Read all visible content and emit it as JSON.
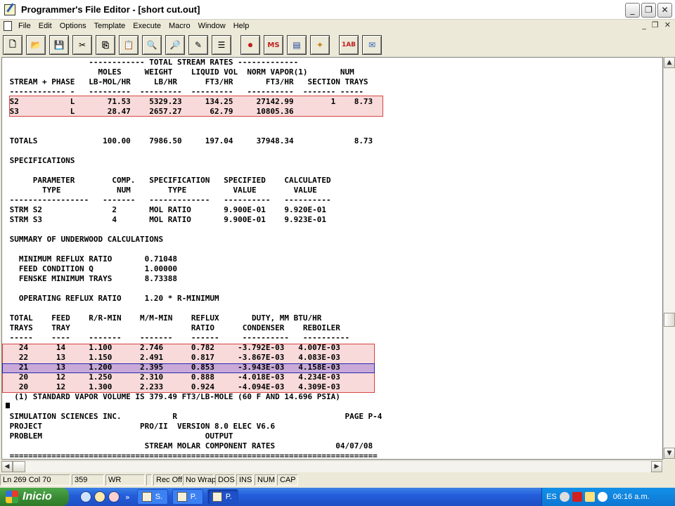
{
  "window": {
    "title": "Programmer's File Editor - [short cut.out]",
    "buttons": {
      "minimize": "_",
      "maximize": "❐",
      "close": "✕"
    }
  },
  "menu": [
    "File",
    "Edit",
    "Options",
    "Template",
    "Execute",
    "Macro",
    "Window",
    "Help"
  ],
  "mdi_buttons": {
    "minimize": "_",
    "restore": "❐",
    "close": "✕"
  },
  "toolbar": {
    "buttons": [
      {
        "name": "new-file-icon",
        "glyph": "🗋"
      },
      {
        "name": "open-folder-icon",
        "glyph": "📂"
      },
      {
        "name": "save-disk-icon",
        "glyph": "💾"
      },
      {
        "name": "cut-scissors-icon",
        "glyph": "✂"
      },
      {
        "name": "copy-icon",
        "glyph": "⎘"
      },
      {
        "name": "paste-icon",
        "glyph": "📋"
      },
      {
        "name": "search-icon",
        "glyph": "🔍"
      },
      {
        "name": "find-next-icon",
        "glyph": "🔎"
      },
      {
        "name": "pen-icon",
        "glyph": "✎"
      },
      {
        "name": "list-icon",
        "glyph": "☰"
      },
      {
        "name": "record-macro-icon",
        "glyph": "⏺"
      },
      {
        "name": "ms-dos-icon",
        "glyph": "MS"
      },
      {
        "name": "window-icon",
        "glyph": "▤"
      },
      {
        "name": "wand-icon",
        "glyph": "✦"
      },
      {
        "name": "1ab-2cl-icon",
        "glyph": "1AB"
      },
      {
        "name": "stamp-icon",
        "glyph": "✉"
      }
    ]
  },
  "editor": {
    "lines": [
      "                  ------------ TOTAL STREAM RATES -------------",
      "                    MOLES     WEIGHT    LIQUID VOL  NORM VAPOR(1)       NUM",
      " STREAM + PHASE   LB-MOL/HR     LB/HR      FT3/HR       FT3/HR   SECTION TRAYS",
      " ------------ -   ---------  ---------  ---------   ----------  ------- -----",
      " S2           L       71.53    5329.23     134.25     27142.99        1    8.73",
      " S3           L       28.47    2657.27      62.79     10805.36",
      "",
      "",
      " TOTALS              100.00    7986.50     197.04     37948.34             8.73",
      "",
      " SPECIFICATIONS",
      "",
      "      PARAMETER        COMP.   SPECIFICATION   SPECIFIED    CALCULATED",
      "        TYPE            NUM        TYPE          VALUE        VALUE",
      " -----------------   -------   -------------   ----------   ----------",
      " STRM S2               2       MOL RATIO       9.900E-01    9.920E-01",
      " STRM S3               4       MOL RATIO       9.900E-01    9.923E-01",
      "",
      " SUMMARY OF UNDERWOOD CALCULATIONS",
      "",
      "   MINIMUM REFLUX RATIO       0.71048",
      "   FEED CONDITION Q           1.00000",
      "   FENSKE MINIMUM TRAYS       8.73388",
      "",
      "   OPERATING REFLUX RATIO     1.20 * R-MINIMUM",
      "",
      " TOTAL    FEED    R/R-MIN    M/M-MIN    REFLUX       DUTY, MM BTU/HR",
      " TRAYS    TRAY                          RATIO      CONDENSER    REBOILER",
      " -----    ----    -------    -------    ------     ----------   ----------",
      "   24      14     1.100      2.746      0.782     -3.792E-03   4.007E-03",
      "   22      13     1.150      2.491      0.817     -3.867E-03   4.083E-03",
      "   21      13     1.200      2.395      0.853     -3.943E-03   4.158E-03",
      "   20      12     1.250      2.310      0.888     -4.018E-03   4.234E-03",
      "   20      12     1.300      2.233      0.924     -4.094E-03   4.309E-03",
      "  (1) STANDARD VAPOR VOLUME IS 379.49 FT3/LB-MOLE (60 F AND 14.696 PSIA)",
      "",
      " SIMULATION SCIENCES INC.           R                                    PAGE P-4",
      " PROJECT                     PRO/II  VERSION 8.0 ELEC V6.6",
      " PROBLEM                                   OUTPUT",
      "                              STREAM MOLAR COMPONENT RATES             04/07/08",
      " ==============================================================================="
    ]
  },
  "status": [
    "Ln 269 Col 70",
    "359",
    "WR",
    "",
    "Rec Off",
    "No Wrap",
    "DOS",
    "INS",
    "NUM",
    "CAP"
  ],
  "taskbar": {
    "start_label": "Inicio",
    "more_label": "»",
    "tasks": [
      "S.",
      "P.",
      "P."
    ],
    "language": "ES",
    "clock": "06:16 a.m."
  },
  "colors": {
    "highlight_red": "#d64545",
    "highlight_blue": "#2a2ab0",
    "taskbar": "#245edb"
  }
}
